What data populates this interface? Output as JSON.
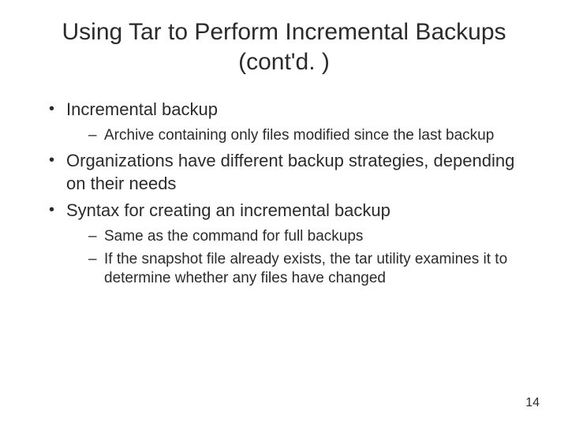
{
  "title": "Using Tar to Perform Incremental Backups (cont'd. )",
  "bullets": {
    "b1": "Incremental backup",
    "b1a": "Archive containing only files modified since the last backup",
    "b2": "Organizations have different backup strategies, depending on their needs",
    "b3": "Syntax for creating an incremental backup",
    "b3a": "Same as the command for full backups",
    "b3b": "If the snapshot file already exists, the tar utility examines it to determine whether any files have changed"
  },
  "pageNumber": "14"
}
